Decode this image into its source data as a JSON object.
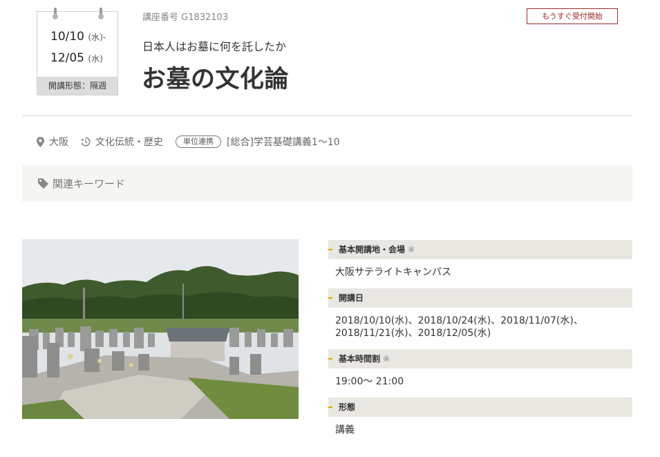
{
  "calendar": {
    "start_date": "10/10",
    "start_day": "(水)-",
    "end_date": "12/05",
    "end_day": "(水)",
    "format_label": "開講形態：隔週"
  },
  "course": {
    "code": "講座番号 G1832103",
    "subtitle": "日本人はお墓に何を託したか",
    "title": "お墓の文化論",
    "status_badge": "もうすぐ受付開始"
  },
  "meta": {
    "location": "大阪",
    "category": "文化伝統・歴史",
    "credit_pill": "単位連携",
    "credit_text": "[総合]学芸基礎講義1〜10"
  },
  "keywords": {
    "label": "関連キーワード"
  },
  "details": [
    {
      "heading": "基本開講地・会場",
      "mark": "※",
      "value": "大阪サテライトキャンパス"
    },
    {
      "heading": "開講日",
      "mark": "",
      "value": "2018/10/10(水)、2018/10/24(水)、2018/11/07(水)、2018/11/21(水)、2018/12/05(水)"
    },
    {
      "heading": "基本時間割",
      "mark": "※",
      "value": "19:00〜 21:00"
    },
    {
      "heading": "形態",
      "mark": "",
      "value": "講義"
    }
  ],
  "colors": {
    "accent": "#e0a000",
    "badge": "#9e2a2a",
    "section_bg": "#e9e7e1",
    "keyword_bg": "#f5f5f1"
  }
}
